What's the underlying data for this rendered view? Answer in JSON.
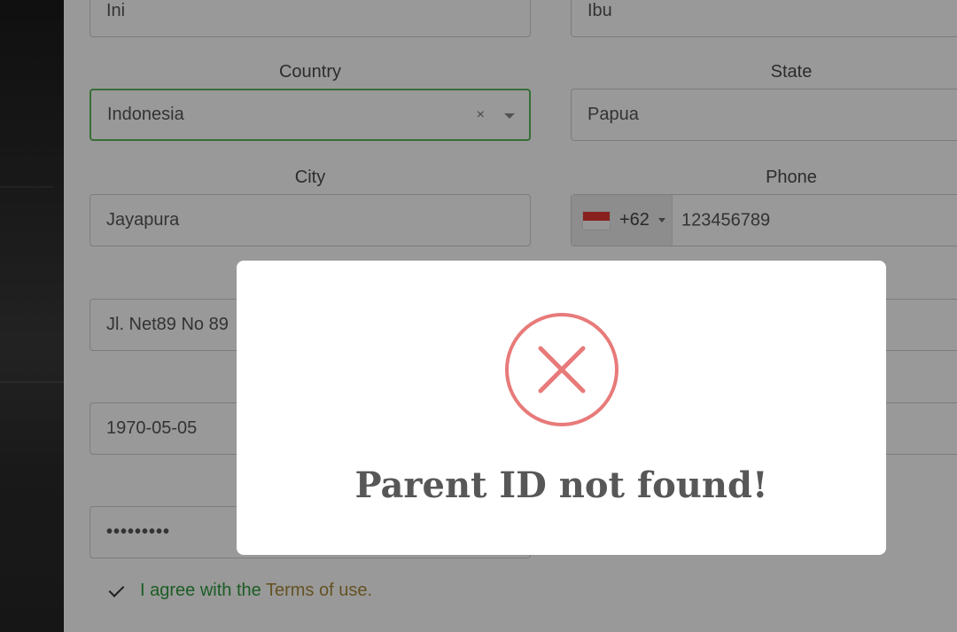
{
  "form": {
    "first_name": {
      "value": "Ini"
    },
    "last_name": {
      "value": "Ibu"
    },
    "country": {
      "label": "Country",
      "value": "Indonesia",
      "clear": "×"
    },
    "state": {
      "label": "State",
      "value": "Papua"
    },
    "city": {
      "label": "City",
      "value": "Jayapura"
    },
    "phone": {
      "label": "Phone",
      "dial_code": "+62",
      "number": "123456789",
      "flag": "indonesia-flag"
    },
    "address": {
      "value": "Jl. Net89 No 89"
    },
    "birth_date": {
      "value": "1970-05-05"
    },
    "password": {
      "value": "•••••••••"
    },
    "agree": {
      "text": "I agree with the",
      "link": "Terms of use",
      "suffix": ".",
      "checked": true
    }
  },
  "modal": {
    "icon": "error-x-icon",
    "title": "Parent ID not found!"
  },
  "colors": {
    "error": "#e87a7a",
    "focus_border": "#5cb85c",
    "agree_text": "#2e9b3e",
    "terms_link": "#a8893a"
  }
}
